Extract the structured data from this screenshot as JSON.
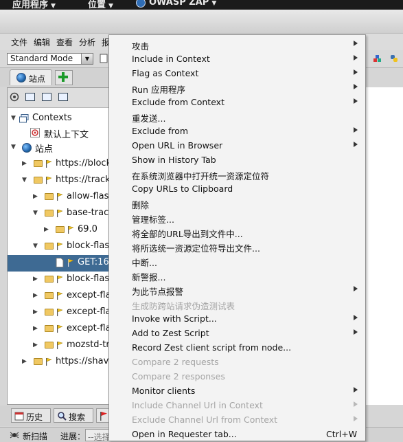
{
  "top_panel": {
    "applications": "应用程序",
    "places": "位置",
    "zap": "OWASP ZAP"
  },
  "menubar": [
    "文件",
    "编辑",
    "查看",
    "分析",
    "报"
  ],
  "toolbar": {
    "mode": "Standard Mode"
  },
  "sites_tab": {
    "label": "站点"
  },
  "tree": {
    "contexts": "Contexts",
    "default_context": "默认上下文",
    "sites": "站点",
    "nodes": [
      "https://block",
      "https://track",
      "allow-flash",
      "base-trac",
      "69.0",
      "block-flas",
      "GET:16",
      "block-flas",
      "except-fla",
      "except-fla",
      "except-fla",
      "mozstd-tra",
      "https://shava"
    ]
  },
  "bottom_tabs": {
    "history": "历史",
    "search": "搜索"
  },
  "statusbar": {
    "new_scan": "新扫描",
    "progress": "进展：",
    "select_placeholder": "--选择"
  },
  "context_menu": {
    "items": [
      {
        "label": "攻击",
        "submenu": true,
        "enabled": true
      },
      {
        "label": "Include in Context",
        "submenu": true,
        "enabled": true
      },
      {
        "label": "Flag as Context",
        "submenu": true,
        "enabled": true
      },
      {
        "label": "Run 应用程序",
        "submenu": true,
        "enabled": true
      },
      {
        "label": "Exclude from Context",
        "submenu": true,
        "enabled": true
      },
      {
        "label": "重发送...",
        "submenu": false,
        "enabled": true
      },
      {
        "label": "Exclude from",
        "submenu": true,
        "enabled": true
      },
      {
        "label": "Open URL in Browser",
        "submenu": true,
        "enabled": true
      },
      {
        "label": "Show in History Tab",
        "submenu": false,
        "enabled": true
      },
      {
        "label": "在系统浏览器中打开统一资源定位符",
        "submenu": false,
        "enabled": true
      },
      {
        "label": "Copy URLs to Clipboard",
        "submenu": false,
        "enabled": true
      },
      {
        "label": "删除",
        "submenu": false,
        "enabled": true
      },
      {
        "label": "管理标签...",
        "submenu": false,
        "enabled": true
      },
      {
        "label": "将全部的URL导出到文件中...",
        "submenu": false,
        "enabled": true
      },
      {
        "label": "将所选统一资源定位符导出文件...",
        "submenu": false,
        "enabled": true
      },
      {
        "label": "中断...",
        "submenu": false,
        "enabled": true
      },
      {
        "label": "新警报...",
        "submenu": false,
        "enabled": true
      },
      {
        "label": "为此节点报警",
        "submenu": true,
        "enabled": true
      },
      {
        "label": "生成防跨站请求伪造测试表",
        "submenu": false,
        "enabled": false
      },
      {
        "label": "Invoke with Script...",
        "submenu": true,
        "enabled": true
      },
      {
        "label": "Add to Zest Script",
        "submenu": true,
        "enabled": true
      },
      {
        "label": "Record Zest client script from node...",
        "submenu": false,
        "enabled": true
      },
      {
        "label": "Compare 2 requests",
        "submenu": false,
        "enabled": false
      },
      {
        "label": "Compare 2 responses",
        "submenu": false,
        "enabled": false
      },
      {
        "label": "Monitor clients",
        "submenu": true,
        "enabled": true
      },
      {
        "label": "Include Channel Url in Context",
        "submenu": true,
        "enabled": false
      },
      {
        "label": "Exclude Channel Url from Context",
        "submenu": true,
        "enabled": false
      },
      {
        "label": "Open in Requester tab...",
        "submenu": false,
        "enabled": true,
        "accelerator": "Ctrl+W"
      }
    ]
  }
}
